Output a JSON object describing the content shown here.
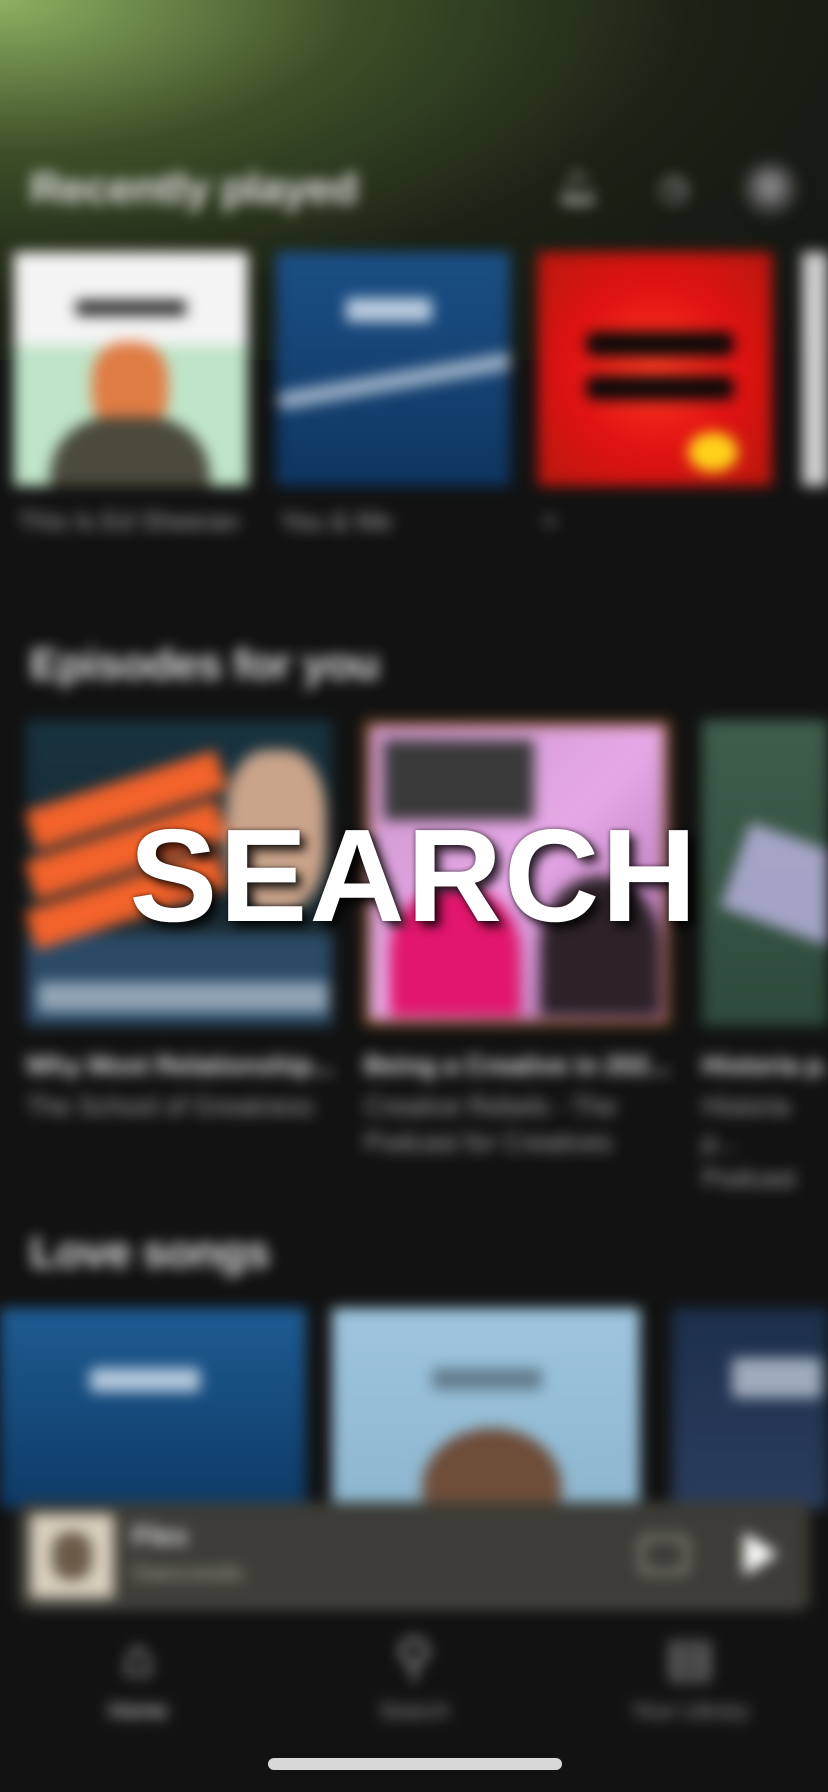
{
  "header": {
    "recently_played_title": "Recently played",
    "icons": [
      "bell-icon",
      "history-icon",
      "settings-icon"
    ]
  },
  "recently_played": [
    {
      "caption": "This Is Ed Sheeran"
    },
    {
      "caption": "You & Me"
    },
    {
      "caption": "="
    },
    {
      "caption": ""
    }
  ],
  "episodes": {
    "title": "Episodes for you",
    "items": [
      {
        "title": "Why Most Relationship...",
        "subtitle": "The School of Greatness"
      },
      {
        "title": "Being a Creative in 202...",
        "subtitle": "Creative Rebels - The Podcast for Creatives"
      },
      {
        "title": "Historia p...",
        "subtitle": "Historia p... Podcast"
      }
    ]
  },
  "love_songs": {
    "title": "Love songs"
  },
  "mini_player": {
    "title": "Flex",
    "artist": "Dancrestic",
    "progress": 0.0
  },
  "bottom_nav": {
    "home_label": "Home",
    "search_label": "Search",
    "library_label": "Your Library"
  },
  "overlay": {
    "text": "SEARCH"
  },
  "colors": {
    "background": "#121212",
    "gradient_top": "#8fb062",
    "mini_player_bg": "#3d3c36"
  }
}
